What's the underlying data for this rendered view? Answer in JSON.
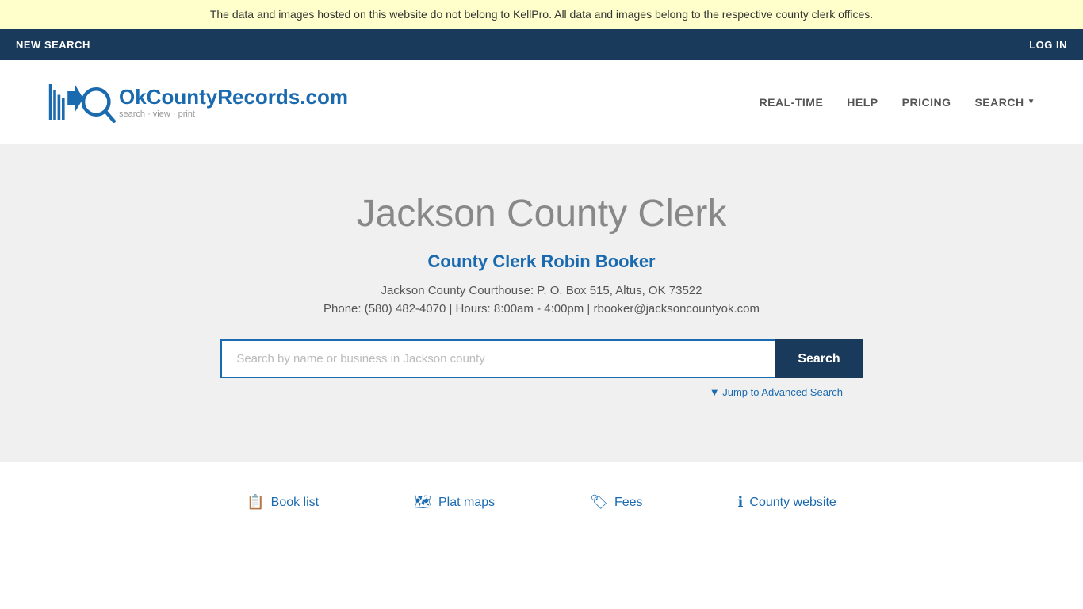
{
  "banner": {
    "text": "The data and images hosted on this website do not belong to KellPro. All data and images belong to the respective county clerk offices."
  },
  "top_nav": {
    "new_search": "NEW SEARCH",
    "log_in": "LOG IN"
  },
  "header": {
    "logo_text": "OkCountyRecords.com",
    "logo_tagline": "search · view · print",
    "nav": {
      "real_time": "REAL-TIME",
      "help": "HELP",
      "pricing": "PRICING",
      "search": "SEARCH"
    }
  },
  "hero": {
    "title": "Jackson County Clerk",
    "clerk_name": "County Clerk Robin Booker",
    "address": "Jackson County Courthouse: P. O. Box 515, Altus, OK 73522",
    "phone_hours": "Phone: (580) 482-4070 | Hours: 8:00am - 4:00pm | rbooker@jacksoncountyok.com",
    "search_placeholder": "Search by name or business in Jackson county",
    "search_button": "Search",
    "advanced_search": "▼ Jump to Advanced Search"
  },
  "footer_links": [
    {
      "icon": "📋",
      "label": "Book list"
    },
    {
      "icon": "🗺",
      "label": "Plat maps"
    },
    {
      "icon": "🏷",
      "label": "Fees"
    },
    {
      "icon": "ℹ",
      "label": "County website"
    }
  ]
}
